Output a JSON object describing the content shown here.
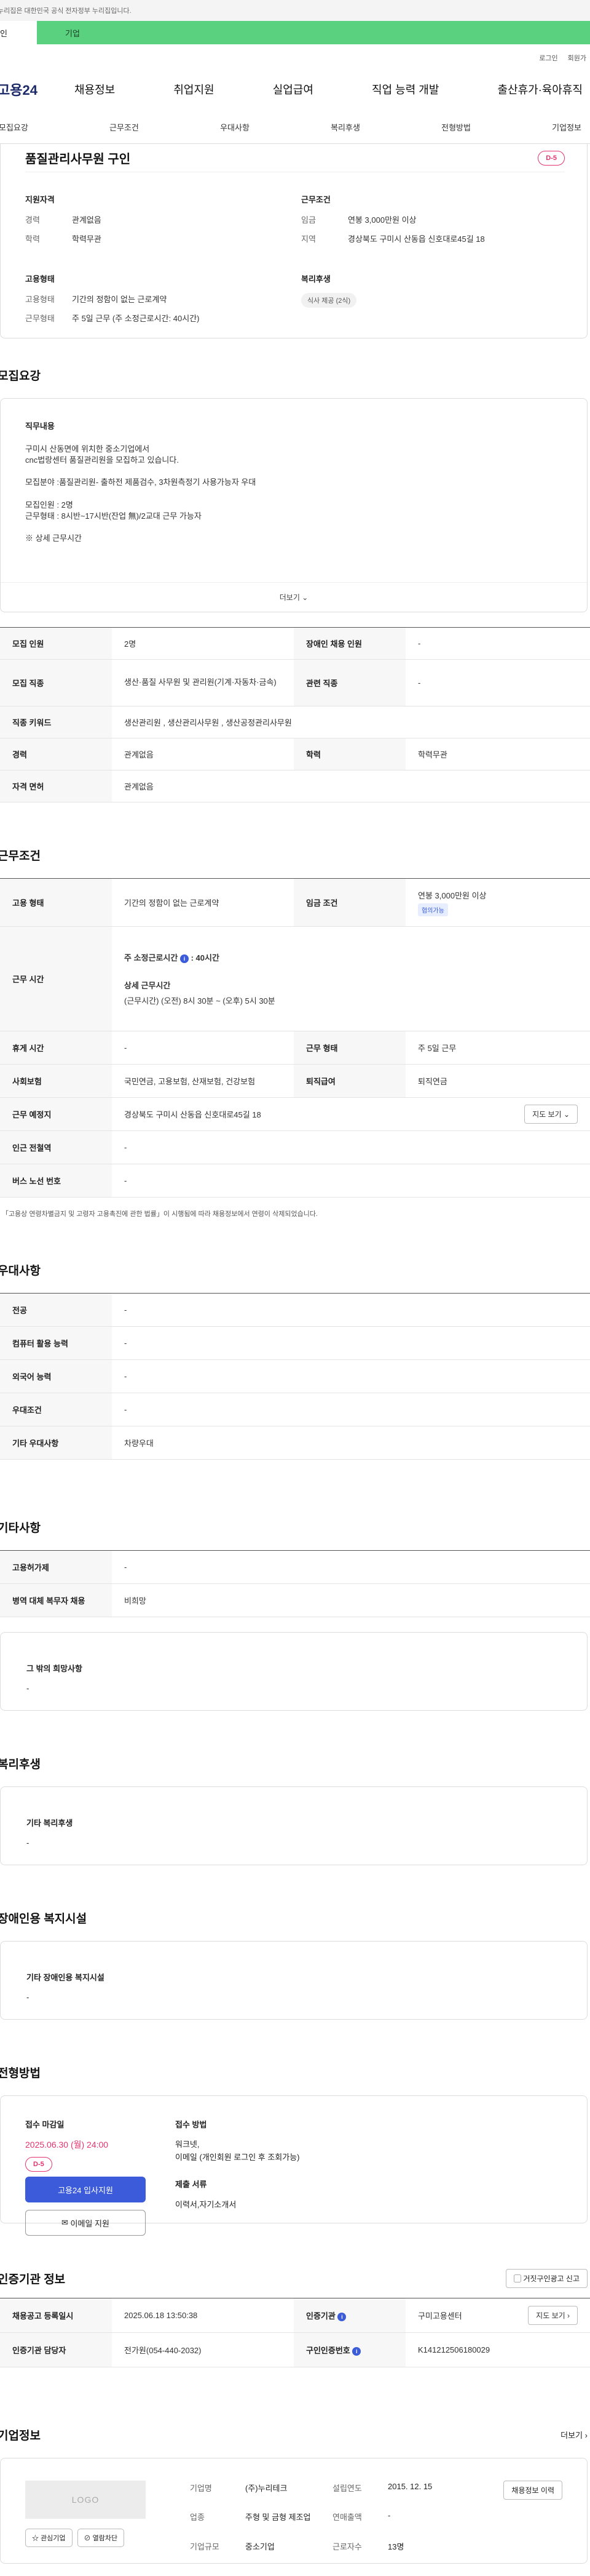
{
  "gov_notice": "누리집은 대한민국 공식 전자정부 누리집입니다.",
  "user_tabs": {
    "individual": "인",
    "company": "기업"
  },
  "util": {
    "login": "로그인",
    "signup": "회원가"
  },
  "gnb": {
    "logo": "고용24",
    "menu": [
      "채용정보",
      "취업지원",
      "실업급여",
      "직업 능력 개발",
      "출산휴가·육아휴직"
    ]
  },
  "subnav": [
    "모집요강",
    "근무조건",
    "우대사항",
    "복리후생",
    "전형방법",
    "기업정보"
  ],
  "job": {
    "title": "품질관리사무원 구인",
    "dday": "D-5",
    "qual": {
      "heading": "지원자격",
      "rows": [
        {
          "k": "경력",
          "v": "관계없음"
        },
        {
          "k": "학력",
          "v": "학력무관"
        }
      ]
    },
    "cond": {
      "heading": "근무조건",
      "rows": [
        {
          "k": "임금",
          "v": "연봉 3,000만원 이상"
        },
        {
          "k": "지역",
          "v": "경상북도 구미시 산동읍 신호대로45길 18"
        }
      ]
    },
    "emp": {
      "heading": "고용형태",
      "rows": [
        {
          "k": "고용형태",
          "v": "기간의 정함이 없는 근로계약"
        },
        {
          "k": "근무형태",
          "v": "주 5일 근무 (주 소정근로시간: 40시간)"
        }
      ]
    },
    "welfare": {
      "heading": "복리후생",
      "chip": "식사 제공 (2식)"
    }
  },
  "recruit": {
    "title": "모집요강",
    "desc_heading": "직무내용",
    "desc_lines": [
      "구미시 산동면에 위치한 중소기업에서",
      "cnc법랑센터 품질관리원을 모집하고 있습니다.",
      "",
      "모집분야 :품질관리원- 출하전 제품검수, 3차원측정기 사용가능자 우대",
      "",
      "모집인원 : 2명",
      "근무형태 : 8시반~17시반(잔업 無)/2교대 근무 가능자",
      "",
      "※ 상세 근무시간"
    ],
    "more": "더보기",
    "table": {
      "r1": {
        "k1": "모집 인원",
        "v1": "2명",
        "k2": "장애인 채용 인원",
        "v2": "-"
      },
      "r2": {
        "k1": "모집 직종",
        "v1": "생산·품질 사무원 및 관리원(기계·자동차·금속)",
        "k2": "관련 직종",
        "v2": "-"
      },
      "r3": {
        "k1": "직종 키워드",
        "v1": "생산관리원 , 생산관리사무원 , 생산공정관리사무원"
      },
      "r4": {
        "k1": "경력",
        "v1": "관계없음",
        "k2": "학력",
        "v2": "학력무관"
      },
      "r5": {
        "k1": "자격 면허",
        "v1": "관계없음"
      }
    }
  },
  "work": {
    "title": "근무조건",
    "emp_type": {
      "k": "고용 형태",
      "v": "기간의 정함이 없는 근로계약"
    },
    "wage": {
      "k": "임금 조건",
      "v": "연봉 3,000만원 이상",
      "badge": "협의가능"
    },
    "hours": {
      "k": "근무 시간",
      "weekly_label": "주 소정근로시간",
      "weekly_value": ": 40시간",
      "detail_label": "상세 근무시간",
      "detail_value": "(근무시간) (오전) 8시 30분 ~ (오후) 5시 30분"
    },
    "rest": {
      "k": "휴게 시간",
      "v": "-",
      "k2": "근무 형태",
      "v2": "주 5일 근무"
    },
    "insurance": {
      "k": "사회보험",
      "v": "국민연금, 고용보험, 산재보험, 건강보험",
      "k2": "퇴직급여",
      "v2": "퇴직연금"
    },
    "location": {
      "k": "근무 예정지",
      "v": "경상북도 구미시 산동읍 신호대로45길 18",
      "btn": "지도 보기"
    },
    "subway": {
      "k": "인근 전철역",
      "v": "-"
    },
    "bus": {
      "k": "버스 노선 번호",
      "v": "-"
    },
    "note": "「고용상 연령차별금지 및 고령자 고용촉진에 관한 법률」이 시행됨에 따라 채용정보에서 연령이 삭제되었습니다."
  },
  "pref": {
    "title": "우대사항",
    "rows": [
      {
        "k": "전공",
        "v": "-"
      },
      {
        "k": "컴퓨터 활용 능력",
        "v": "-"
      },
      {
        "k": "외국어 능력",
        "v": "-"
      },
      {
        "k": "우대조건",
        "v": "-"
      },
      {
        "k": "기타 우대사항",
        "v": "차량우대"
      }
    ]
  },
  "etc": {
    "title": "기타사항",
    "rows": [
      {
        "k": "고용허가제",
        "v": "-"
      },
      {
        "k": "병역 대체 복무자 채용",
        "v": "비희망"
      }
    ],
    "box_heading": "그 밖의 희망사항",
    "box_value": "-"
  },
  "benefit": {
    "title": "복리후생",
    "box_heading": "기타 복리후생",
    "box_value": "-"
  },
  "disabled": {
    "title": "장애인용 복지시설",
    "box_heading": "기타 장애인용 복지시설",
    "box_value": "-"
  },
  "screening": {
    "title": "전형방법",
    "deadline_label": "접수 마감일",
    "deadline": "2025.06.30 (월) 24:00",
    "dday": "D-5",
    "btn_apply": "고용24 입사지원",
    "btn_email": "이메일 지원",
    "method_label": "접수 방법",
    "method_lines": [
      "워크넷,",
      "이메일 (개인회원 로그인 후 조회가능)"
    ],
    "docs_label": "제출 서류",
    "docs": "이력서,자기소개서"
  },
  "cert": {
    "title": "인증기관 정보",
    "report_btn": "거짓구인광고 신고",
    "r1": {
      "k1": "채용공고 등록일시",
      "v1": "2025.06.18 13:50:38",
      "k2": "인증기관",
      "v2": "구미고용센터",
      "btn": "지도 보기"
    },
    "r2": {
      "k1": "인증기관 담당자",
      "v1": "전가원(054-440-2032)",
      "k2": "구인인증번호",
      "v2": "K141212506180029"
    }
  },
  "company": {
    "title": "기업정보",
    "more": "더보기",
    "logo": "LOGO",
    "btn_fav": "관심기업",
    "btn_block": "열람차단",
    "btn_jobs": "채용정보 이력",
    "fields": [
      {
        "k": "기업명",
        "v": "(주)누리테크"
      },
      {
        "k": "설립연도",
        "v": "2015. 12. 15"
      },
      {
        "k": "업종",
        "v": "주형 및 금형 제조업"
      },
      {
        "k": "연매출액",
        "v": "-"
      },
      {
        "k": "기업규모",
        "v": "중소기업"
      },
      {
        "k": "근로자수",
        "v": "13명"
      }
    ]
  },
  "colors": {
    "accent": "#3b5bdb",
    "dday": "#e4336f",
    "company_tab": "#5ad17e"
  }
}
